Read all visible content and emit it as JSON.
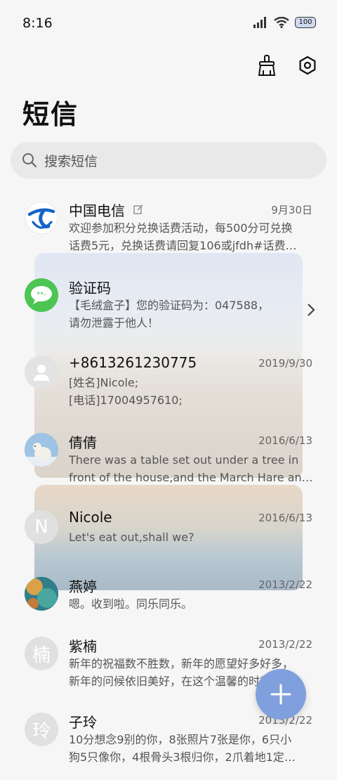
{
  "status": {
    "time": "8:16",
    "battery": "100"
  },
  "header": {
    "title": "短信"
  },
  "search": {
    "placeholder": "搜索短信"
  },
  "threads": [
    {
      "name": "中国电信",
      "date": "9月30日",
      "avatar": "china-telecom-logo",
      "lines": [
        "欢迎参加积分兑换话费活动，每500分可兑换",
        "话费5元，兑换话费请回复106或jfdh#话费…"
      ]
    },
    {
      "name": "验证码",
      "date": "",
      "avatar": "sms-bubble",
      "lines": [
        "【毛绒盒子】您的验证码为：047588，",
        "请勿泄露于他人！"
      ]
    },
    {
      "name": "+8613261230775",
      "date": "2019/9/30",
      "avatar": "person",
      "lines": [
        "[姓名]Nicole;",
        "[电话]17004957610;"
      ]
    },
    {
      "name": "倩倩",
      "date": "2016/6/13",
      "avatar": "polar-bear-photo",
      "lines": [
        "There was a table set out under a tree in",
        "front of the house,and the March Hare an…"
      ]
    },
    {
      "name": "Nicole",
      "date": "2016/6/13",
      "avatar": "N",
      "lines": [
        "Let's eat out,shall we?"
      ]
    },
    {
      "name": "燕婷",
      "date": "2013/2/22",
      "avatar": "coral-photo",
      "lines": [
        "嗯。收到啦。同乐同乐。"
      ]
    },
    {
      "name": "紫楠",
      "date": "2013/2/22",
      "avatar": "楠",
      "lines": [
        "新年的祝福数不胜数，新年的愿望好多好多，",
        "新年的问候依旧美好，在这个温馨的时刻，…"
      ]
    },
    {
      "name": "子玲",
      "date": "2013/2/22",
      "avatar": "玲",
      "lines": [
        "10分想念9别的你，8张照片7张是你，6只小",
        "狗5只像你，4根骨头3根归你，2爪着地1定…"
      ]
    }
  ],
  "colors": {
    "accent": "#7fa0dc",
    "green": "#4cc552",
    "telecom": "#1464c8"
  }
}
